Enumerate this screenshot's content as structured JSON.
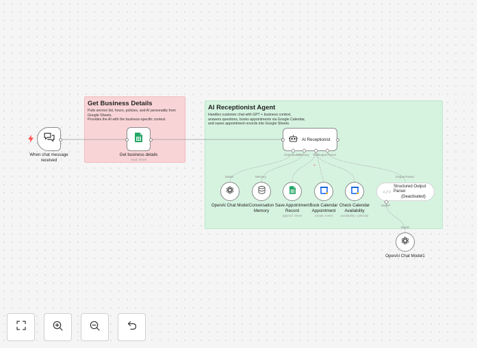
{
  "sticky_business": {
    "title": "Get Business Details",
    "body": "Pulls service list, hours, policies, and AI personality from Google Sheets.\nProvides the AI with the business-specific context."
  },
  "sticky_agent": {
    "title": "AI Receptionist Agent",
    "body": "Handles customer chat with GPT + business context,\nanswers questions, books appointments via Google Calendar,\nand saves appointment records into Google Sheets."
  },
  "nodes": {
    "trigger": {
      "label": "When chat message received",
      "icon": "chat-bubbles-icon"
    },
    "get_business": {
      "label": "Get business details",
      "sub": "read: sheet",
      "icon": "google-sheets-icon"
    },
    "agent": {
      "label": "AI Receptionist",
      "icon": "robot-icon"
    },
    "openai_model": {
      "label": "OpenAI Chat Model",
      "icon": "openai-icon"
    },
    "memory": {
      "label": "Conversation Memory",
      "icon": "database-icon"
    },
    "save_appt": {
      "label": "Save Appointment Record",
      "sub": "append: sheet",
      "icon": "google-sheets-icon"
    },
    "book_cal": {
      "label": "Book Calendar Appointment",
      "sub": "create: event",
      "icon": "google-calendar-icon"
    },
    "check_cal": {
      "label": "Check Calendar Availability",
      "sub": "availability: calendar",
      "icon": "google-calendar-icon"
    },
    "parser": {
      "label": "Structured Output Parser",
      "status": "(Deactivated)",
      "icon": "code-brackets-icon"
    },
    "openai_model1": {
      "label": "OpenAI Chat Model1",
      "icon": "openai-icon"
    }
  },
  "ports": {
    "chat_model": "Chat Model*",
    "memory": "Memory",
    "tool": "Tool",
    "output_parser": "Output Parser",
    "model_star": "Model*",
    "model": "Model"
  },
  "controls": {
    "fit": "fit-view-icon",
    "zoom_in": "zoom-in-icon",
    "zoom_out": "zoom-out-icon",
    "undo": "undo-icon"
  },
  "colors": {
    "sticky_red": "#f9d4d6",
    "sticky_green": "#d6f3e0",
    "trigger_bolt": "#ff4d4d",
    "sheets_green": "#23a566",
    "tool_red": "#ff6d6d"
  }
}
